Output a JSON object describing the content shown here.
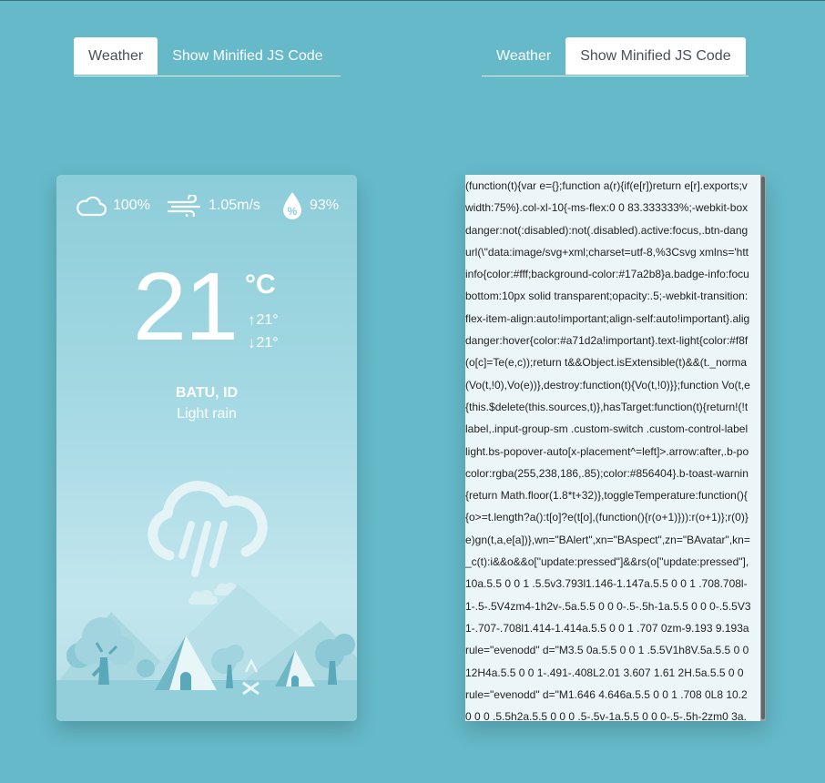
{
  "left_tabs": {
    "weather": "Weather",
    "code": "Show Minified JS Code",
    "active": "weather"
  },
  "right_tabs": {
    "weather": "Weather",
    "code": "Show Minified JS Code",
    "active": "code"
  },
  "weather": {
    "cloudiness": "100%",
    "wind_speed": "1.05m/s",
    "humidity": "93%",
    "temperature": "21",
    "unit": "°C",
    "temp_max": "21°",
    "temp_min": "21°",
    "location": "BATU, ID",
    "description": "Light rain",
    "icons": {
      "cloudiness": "cloud-icon",
      "wind": "wind-icon",
      "humidity": "humidity-drop-icon",
      "condition": "rain-cloud-icon",
      "max": "arrow-up-icon",
      "min": "arrow-down-icon"
    }
  },
  "code_lines": [
    "(function(t){var e={};function a(r){if(e[r])return e[r].exports;v",
    "width:75%}.col-xl-10{-ms-flex:0 0 83.333333%;-webkit-box",
    "danger:not(:disabled):not(.disabled).active:focus,.btn-dang",
    "url(\\\"data:image/svg+xml;charset=utf-8,%3Csvg xmlns='htt",
    "info{color:#fff;background-color:#17a2b8}a.badge-info:focu",
    "bottom:10px solid transparent;opacity:.5;-webkit-transition:",
    "flex-item-align:auto!important;align-self:auto!important}.alig",
    "danger:hover{color:#a71d2a!important}.text-light{color:#f8f",
    "(o[c]=Te(e,c));return t&&Object.isExtensible(t)&&(t._norma",
    "(Vo(t,!0),Vo(e))},destroy:function(t){Vo(t,!0)}};function Vo(t,e",
    "{this.$delete(this.sources,t)},hasTarget:function(t){return!(!t",
    "label,.input-group-sm .custom-switch .custom-control-label",
    "light.bs-popover-auto[x-placement^=left]>.arrow:after,.b-po",
    "color:rgba(255,238,186,.85);color:#856404}.b-toast-warnin",
    "{return Math.floor(1.8*t+32)},toggleTemperature:function(){",
    "{o>=t.length?a():t[o]?e(t[o],(function(){r(o+1)})):r(o+1)};r(0)}",
    "e)gn(t,a,e[a])},wn=\"BAlert\",xn=\"BAspect\",zn=\"BAvatar\",kn=",
    "_c(t):i&&o&&o[\"update:pressed\"]&&rs(o[\"update:pressed\"],",
    "10a.5.5 0 0 1 .5.5v3.793l1.146-1.147a.5.5 0 0 1 .708.708l-",
    "1-.5-.5V4zm4-1h2v-.5a.5.5 0 0 0-.5-.5h-1a.5.5 0 0 0-.5.5V3",
    "1-.707-.708l1.414-1.414a.5.5 0 0 1 .707 0zm-9.193 9.193a",
    "rule=\"evenodd\" d=\"M3.5 0a.5.5 0 0 1 .5.5V1h8V.5a.5.5 0 0",
    "12H4a.5.5 0 0 1-.491-.408L2.01 3.607 1.61 2H.5a.5.5 0 0",
    "rule=\"evenodd\" d=\"M1.646 4.646a.5.5 0 0 1 .708 0L8 10.2",
    "0 0 0 .5.5h2a.5.5 0 0 0 .5-.5v-1a.5.5 0 0 0-.5-.5h-2zm0 3a."
  ]
}
